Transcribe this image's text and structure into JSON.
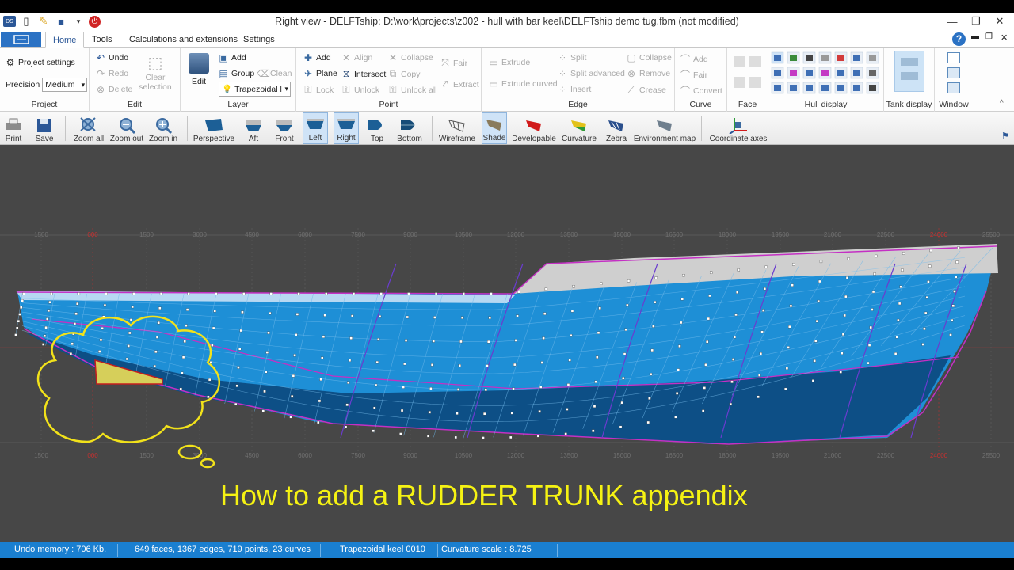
{
  "window": {
    "title": "Right view - DELFTship: D:\\work\\projects\\z002 - hull with bar keel\\DELFTship demo tug.fbm (not modified)",
    "minimize": "—",
    "restore": "❐",
    "close": "✕"
  },
  "ribbon": {
    "tabs": [
      "Home",
      "Tools",
      "Calculations and extensions",
      "Settings"
    ],
    "active_tab": "Home",
    "help_glyph": "?",
    "project": {
      "label": "Project",
      "settings": "Project settings",
      "precision_label": "Precision",
      "precision_value": "Medium"
    },
    "edit": {
      "label": "Edit",
      "undo": "Undo",
      "redo": "Redo",
      "delete": "Delete",
      "clear_selection": "Clear selection"
    },
    "layer": {
      "label": "Layer",
      "edit": "Edit",
      "add": "Add",
      "group": "Group",
      "clean": "Clean",
      "current_value": "Trapezoidal l"
    },
    "point": {
      "label": "Point",
      "add": "Add",
      "plane": "Plane",
      "lock": "Lock",
      "align": "Align",
      "intersect": "Intersect",
      "unlock": "Unlock",
      "collapse": "Collapse",
      "copy": "Copy",
      "unlock_all": "Unlock all",
      "fair": "Fair",
      "extract": "Extract"
    },
    "edge": {
      "label": "Edge",
      "extrude": "Extrude",
      "extrude_curved": "Extrude curved",
      "split": "Split",
      "split_advanced": "Split advanced",
      "insert": "Insert",
      "collapse": "Collapse",
      "remove": "Remove",
      "crease": "Crease"
    },
    "curve": {
      "label": "Curve",
      "add": "Add",
      "fair": "Fair",
      "convert": "Convert"
    },
    "face": {
      "label": "Face"
    },
    "hull_display": {
      "label": "Hull display"
    },
    "tank_display": {
      "label": "Tank display"
    },
    "window_group": {
      "label": "Window"
    }
  },
  "toolbar": {
    "print": "Print",
    "save": "Save",
    "zoom_all": "Zoom all",
    "zoom_out": "Zoom out",
    "zoom_in": "Zoom in",
    "perspective": "Perspective",
    "aft": "Aft",
    "front": "Front",
    "left": "Left",
    "right": "Right",
    "top": "Top",
    "bottom": "Bottom",
    "wireframe": "Wireframe",
    "shade": "Shade",
    "developable": "Developable",
    "curvature": "Curvature",
    "zebra": "Zebra",
    "environment_map": "Environment map",
    "coordinate_axes": "Coordinate axes"
  },
  "viewport": {
    "overlay_text": "How to add a RUDDER TRUNK appendix",
    "ruler_ticks_top": [
      "1500",
      "000",
      "1500",
      "3000",
      "4500",
      "6000",
      "7500",
      "9000",
      "10500",
      "12000",
      "13500",
      "15000",
      "16500",
      "18000",
      "19500",
      "21000",
      "22500",
      "24000",
      "25500"
    ],
    "colors": {
      "background": "#474747",
      "hull": "#1b8fd6",
      "deck": "#c8c8c8",
      "overlay_text": "#f5f213",
      "rudder_trunk": "#d6cf5a"
    }
  },
  "status": {
    "undo_memory": "Undo memory : 706 Kb.",
    "stats": "649 faces, 1367 edges, 719 points, 23 curves",
    "layer": "Trapezoidal keel 0010",
    "curvature": "Curvature scale : 8.725"
  }
}
